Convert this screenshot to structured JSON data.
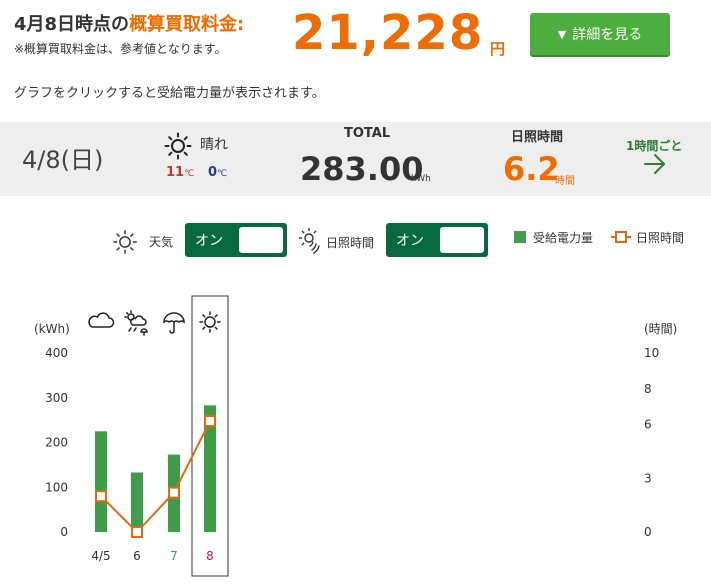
{
  "header": {
    "title_prefix": "4月8日時点の",
    "title_highlight": "概算買取料金:",
    "note": "※概算買取料金は、参考値となります。",
    "amount": "21,228",
    "amount_unit": "円",
    "detail_button": "詳細を見る"
  },
  "hint": "グラフをクリックすると受給電力量が表示されます。",
  "summary": {
    "date": "4/8(日)",
    "weather": "晴れ",
    "temp_high": "11",
    "temp_low": "0",
    "temp_unit": "℃",
    "total_label": "TOTAL",
    "total_value": "283.00",
    "total_unit": "kWh",
    "sun_label": "日照時間",
    "sun_value": "6.2",
    "sun_unit": "時間",
    "hourly_link": "1時間ごと"
  },
  "controls": {
    "weather_label": "天気",
    "weather_toggle": "オン",
    "sun_label": "日照時間",
    "sun_toggle": "オン",
    "legend_power": "受給電力量",
    "legend_sun": "日照時間"
  },
  "colors": {
    "accent": "#f06b00",
    "bar": "#3f9d4a",
    "toggle": "#07693f",
    "date_blue": "#3a8fc9",
    "date_red": "#c2185b"
  },
  "chart_data": {
    "type": "bar",
    "categories": [
      "4/5",
      "6",
      "7",
      "8"
    ],
    "category_colors": [
      "#333333",
      "#333333",
      "#3a8fc9",
      "#c2185b"
    ],
    "weather_icons": [
      "cloud-icon",
      "sun-cloud-rain-icon",
      "umbrella-icon",
      "sun-icon"
    ],
    "selected_index": 3,
    "series": [
      {
        "name": "受給電力量",
        "type": "bar",
        "axis": "left",
        "values": [
          225,
          133,
          173,
          283
        ]
      },
      {
        "name": "日照時間",
        "type": "line",
        "axis": "right",
        "values": [
          2.0,
          0.0,
          2.2,
          6.2
        ]
      }
    ],
    "ylabel": "(kWh)",
    "y2label": "(時間)",
    "ylim": [
      0,
      400
    ],
    "y2lim": [
      0,
      10
    ],
    "yticks": [
      0,
      100,
      200,
      300,
      400
    ],
    "y2ticks": [
      0,
      3,
      6,
      8,
      10
    ],
    "grid": false
  }
}
